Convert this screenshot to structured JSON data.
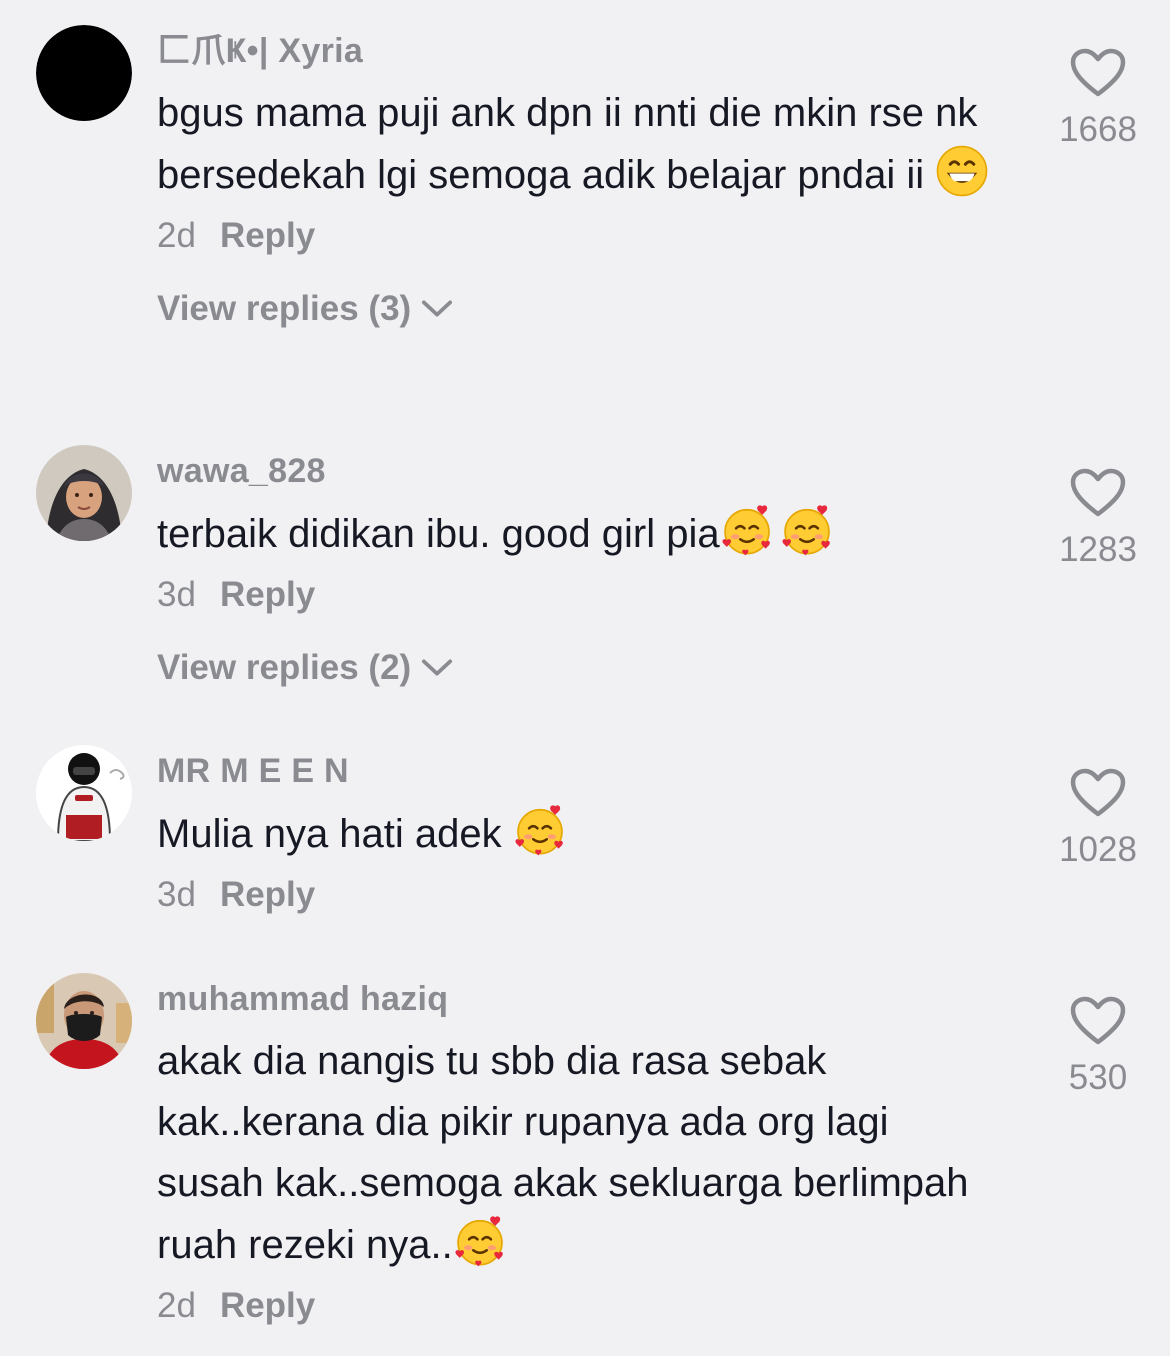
{
  "comments": [
    {
      "username": "匚爪Ҝ•| Xyria",
      "text": "bgus mama puji ank dpn ii nnti die mkin rse nk bersedekah lgi semoga adik belajar pndai ii",
      "emoji": "grinning-face-icon",
      "time": "2d",
      "reply_label": "Reply",
      "view_replies": "View replies (3)",
      "likes": "1668"
    },
    {
      "username": "wawa_828",
      "text": "terbaik didikan ibu. good girl pia",
      "emoji": "smiling-face-with-hearts-icon",
      "time": "3d",
      "reply_label": "Reply",
      "view_replies": "View replies (2)",
      "likes": "1283"
    },
    {
      "username": "MR M E E N",
      "text": "Mulia nya hati adek",
      "emoji": "smiling-face-with-hearts-icon",
      "time": "3d",
      "reply_label": "Reply",
      "likes": "1028"
    },
    {
      "username": "muhammad haziq",
      "text": "akak dia nangis tu sbb dia rasa sebak kak..kerana dia pikir rupanya ada org lagi susah kak..semoga akak sekluarga berlimpah ruah rezeki nya..",
      "emoji": "smiling-face-with-hearts-icon",
      "time": "2d",
      "reply_label": "Reply",
      "likes": "530"
    }
  ],
  "colors": {
    "background": "#f1f1f3",
    "text": "#161823",
    "secondary": "#8a8b91"
  }
}
